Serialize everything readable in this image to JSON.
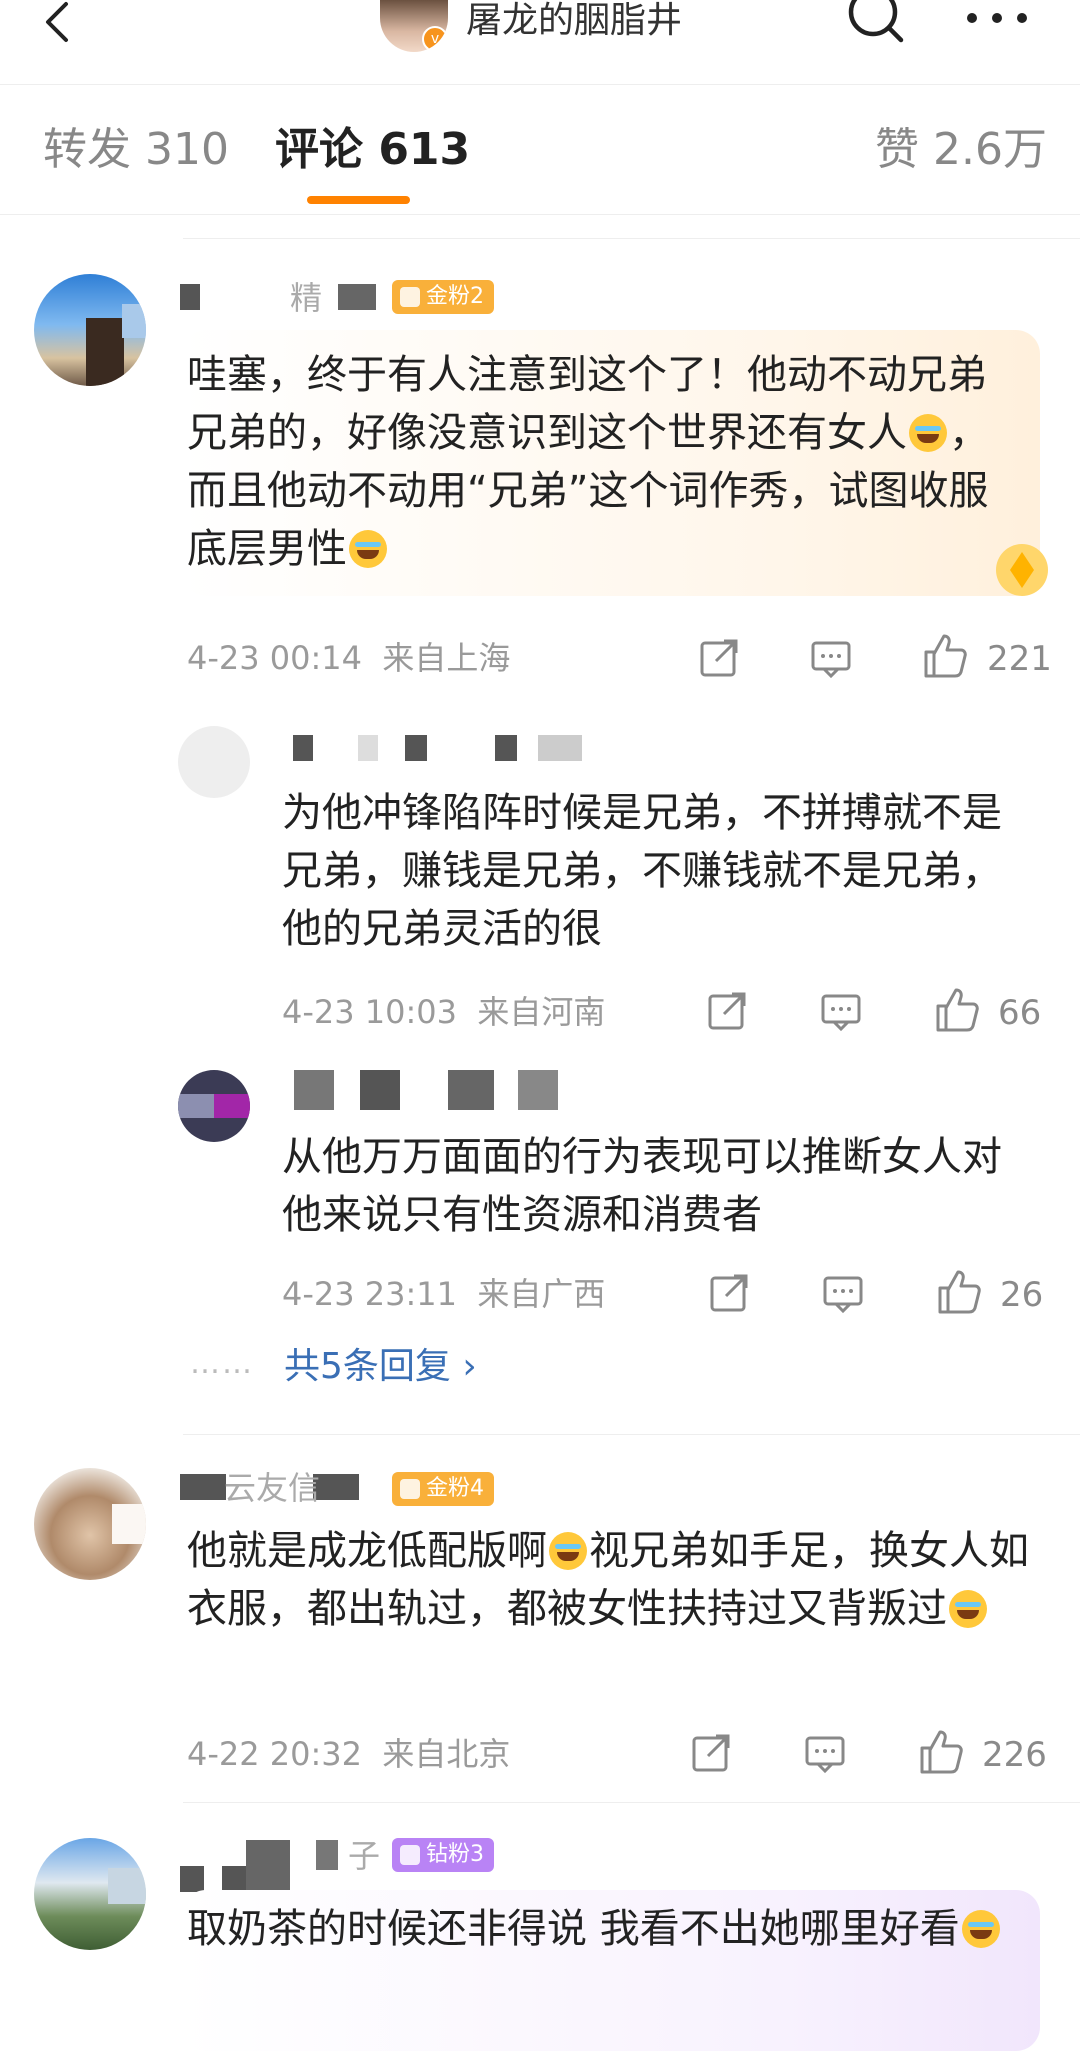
{
  "header": {
    "title": "屠龙的胭脂井",
    "verified_mark": "v"
  },
  "tabs": [
    {
      "label": "转发 310"
    },
    {
      "label": "评论 613"
    },
    {
      "label": "赞 2.6万"
    }
  ],
  "colors": {
    "accent": "#ff8200",
    "link": "#3a6fb5",
    "gold_badge": "#f9b03a",
    "purple_badge": "#b983f5"
  },
  "comments": [
    {
      "name_visible": "精",
      "badge": "金粉2",
      "text_a": "哇塞，终于有人注意到这个了！他动不动兄弟兄弟的，好像没意识到这个世界还有女人",
      "text_b": "，而且他动不动用“兄弟”这个词作秀，试图收服底层男性",
      "time": "4-23 00:14",
      "location": "来自上海",
      "likes": "221"
    },
    {
      "name_visible": "",
      "text": "为他冲锋陷阵时候是兄弟，不拼搏就不是兄弟，赚钱是兄弟，不赚钱就不是兄弟，他的兄弟灵活的很",
      "time": "4-23 10:03",
      "location": "来自河南",
      "likes": "66"
    },
    {
      "name_visible": "",
      "text": "从他万万面面的行为表现可以推断女人对他来说只有性资源和消费者",
      "time": "4-23 23:11",
      "location": "来自广西",
      "likes": "26"
    },
    {
      "name_visible": "云友信",
      "badge": "金粉4",
      "text_a": "他就是成龙低配版啊",
      "text_b": "视兄弟如手足，换女人如衣服，都出轨过，都被女性扶持过又背叛过",
      "time": "4-22 20:32",
      "location": "来自北京",
      "likes": "226"
    },
    {
      "name_visible": "子",
      "badge": "钻粉3",
      "text": "取奶茶的时候还非得说 我看不出她哪里好看"
    }
  ],
  "more_replies": "共5条回复 ›",
  "dots": "……",
  "icons": [
    "back-icon",
    "search-icon",
    "more-icon",
    "share-icon",
    "comment-icon",
    "like-icon"
  ]
}
